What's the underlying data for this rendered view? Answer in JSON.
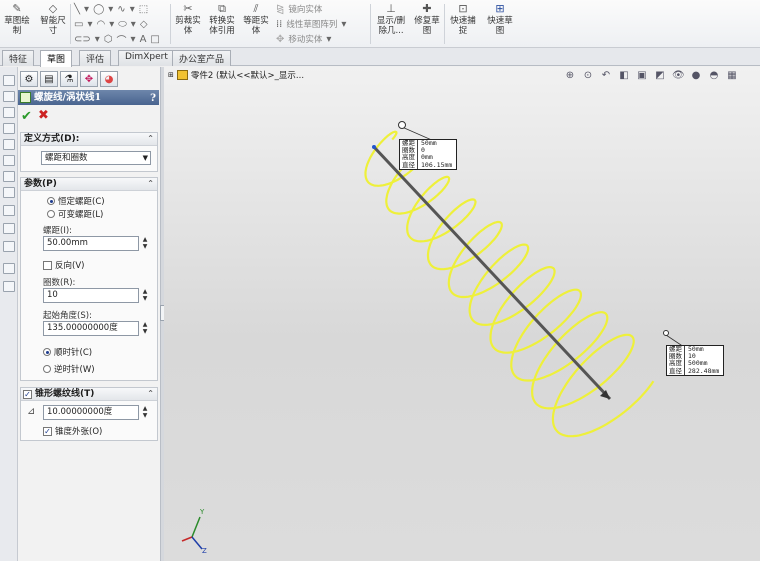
{
  "ribbon": {
    "smart_sketch": {
      "label": "草图绘\n制"
    },
    "smart_dim": {
      "label": "智能尺\n寸"
    },
    "trim": {
      "label": "剪裁实\n体"
    },
    "convert": {
      "label": "转换实\n体引用"
    },
    "offset": {
      "label": "等距实\n体"
    },
    "mirror": {
      "label": "镜向实体"
    },
    "linear_pattern": {
      "label": "线性草图阵列"
    },
    "move": {
      "label": "移动实体"
    },
    "show_delete_relations": {
      "label": "显示/删\n除几..."
    },
    "repair_sketch": {
      "label": "修复草\n图"
    },
    "quick_snap": {
      "label": "快速捕\n捉"
    },
    "rapid_sketch": {
      "label": "快速草\n图"
    }
  },
  "tabs": [
    "特征",
    "草图",
    "评估",
    "DimXpert",
    "办公室产品"
  ],
  "active_tab": "草图",
  "tree": {
    "root": "零件2 (默认<<默认>_显示..."
  },
  "pm": {
    "title": "螺旋线/涡状线1",
    "help": "?",
    "define_group": {
      "title": "定义方式(D):",
      "method": "螺距和圈数"
    },
    "params_group": {
      "title": "参数(P)",
      "constant_pitch": "恒定螺距(C)",
      "variable_pitch": "可变螺距(L)",
      "pitch_label": "螺距(I):",
      "pitch_value": "50.00mm",
      "reverse": "反向(V)",
      "revolutions_label": "圈数(R):",
      "revolutions_value": "10",
      "start_angle_label": "起始角度(S):",
      "start_angle_value": "135.00000000度",
      "clockwise": "顺时针(C)",
      "counterclockwise": "逆时针(W)"
    },
    "taper_group": {
      "title": "锥形螺纹线(T)",
      "angle_value": "10.00000000度",
      "taper_outward": "锥度外张(O)"
    }
  },
  "callout_start": {
    "rows": [
      {
        "k": "螺距",
        "v": "50mm"
      },
      {
        "k": "圈数",
        "v": "0"
      },
      {
        "k": "高度",
        "v": "0mm"
      },
      {
        "k": "直径",
        "v": "106.15mm"
      }
    ]
  },
  "callout_end": {
    "rows": [
      {
        "k": "螺距",
        "v": "50mm"
      },
      {
        "k": "圈数",
        "v": "10"
      },
      {
        "k": "高度",
        "v": "500mm"
      },
      {
        "k": "直径",
        "v": "282.48mm"
      }
    ]
  },
  "triad": {
    "x": "X",
    "y": "Y",
    "z": "Z"
  },
  "colors": {
    "helix": "#eef03a",
    "axis": "#555555",
    "title_bar": "#5873a0"
  }
}
